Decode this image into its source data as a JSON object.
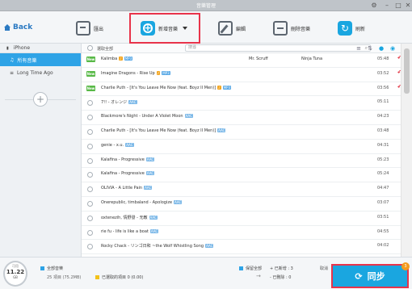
{
  "window": {
    "title": "音樂管理",
    "settings_icon": "gear-icon"
  },
  "toolbar": {
    "back_label": "Back",
    "export_label": "匯出",
    "add_label": "新增音樂",
    "edit_label": "編輯",
    "delete_label": "刪除音樂",
    "refresh_label": "刷新"
  },
  "sidebar": {
    "device": "iPhone",
    "items": [
      {
        "label": "所有音樂",
        "active": true
      },
      {
        "label": "Long Time Ago",
        "active": false
      }
    ]
  },
  "list": {
    "select_all_label": "選取全部",
    "search_placeholder": "搜尋",
    "rows": [
      {
        "new": true,
        "name": "Kalimba",
        "badges": [
          "flag",
          "mp3"
        ],
        "artist": "Mr. Scruff",
        "album": "Ninja Tuna",
        "duration": "05:48",
        "undo": true
      },
      {
        "new": true,
        "name": "Imagine Dragons - Rise Up",
        "badges": [
          "flag",
          "mp3"
        ],
        "artist": "",
        "album": "",
        "duration": "03:52",
        "undo": true
      },
      {
        "new": true,
        "name": "Charlie Puth - [It's You Leave Me Now (feat. Boyz II Men)]",
        "badges": [
          "flag",
          "mp3"
        ],
        "artist": "",
        "album": "",
        "duration": "03:56",
        "undo": true
      },
      {
        "new": false,
        "name": "7!! - オレンジ",
        "badges": [
          "aac"
        ],
        "artist": "",
        "album": "",
        "duration": "05:11",
        "undo": false
      },
      {
        "new": false,
        "name": "Blackmore's Night - Under A Violet Moon",
        "badges": [
          "aac"
        ],
        "artist": "",
        "album": "",
        "duration": "04:23",
        "undo": false
      },
      {
        "new": false,
        "name": "Charlie Puth - [It's You Leave Me Now (feat. Boyz II Men)]",
        "badges": [
          "aac"
        ],
        "artist": "",
        "album": "",
        "duration": "03:48",
        "undo": false
      },
      {
        "new": false,
        "name": "genie - x.u.",
        "badges": [
          "aac"
        ],
        "artist": "",
        "album": "",
        "duration": "04:31",
        "undo": false
      },
      {
        "new": false,
        "name": "Kalafina - Progressive",
        "badges": [
          "aac"
        ],
        "artist": "",
        "album": "",
        "duration": "05:23",
        "undo": false
      },
      {
        "new": false,
        "name": "Kalafina - Progressive",
        "badges": [
          "aac"
        ],
        "artist": "",
        "album": "",
        "duration": "05:24",
        "undo": false
      },
      {
        "new": false,
        "name": "OLIVIA - A Little Pain",
        "badges": [
          "aac"
        ],
        "artist": "",
        "album": "",
        "duration": "04:47",
        "undo": false
      },
      {
        "new": false,
        "name": "Onerepublic, timbaland - Apologize",
        "badges": [
          "aac"
        ],
        "artist": "",
        "album": "",
        "duration": "03:07",
        "undo": false
      },
      {
        "new": false,
        "name": "oxtenezih, 情野發 - 无敵",
        "badges": [
          "aac"
        ],
        "artist": "",
        "album": "",
        "duration": "03:51",
        "undo": false
      },
      {
        "new": false,
        "name": "rie fu - life is like a boat",
        "badges": [
          "aac"
        ],
        "artist": "",
        "album": "",
        "duration": "04:55",
        "undo": false
      },
      {
        "new": false,
        "name": "Rocky Chack - リンゴ日和 ~the Wolf Whistling Song",
        "badges": [
          "aac"
        ],
        "artist": "",
        "album": "",
        "duration": "04:02",
        "undo": false
      }
    ]
  },
  "footer": {
    "storage_label": "可用",
    "storage_value": "11.22",
    "storage_unit": "GB",
    "all_music_label": "全部音樂",
    "all_music_detail": "25 項目 (75.2MB)",
    "selected_label": "已選取的項目 0 (0.00)",
    "keep_all_label": "保留全部",
    "added_label": "+ 已新增 : 3",
    "deleted_label": "- 已刪除 : 0",
    "cancel_label": "取消",
    "sync_label": "同步",
    "sync_badge": "3"
  },
  "colors": {
    "accent": "#1aa6e0",
    "highlight": "#e8334a",
    "new_tag": "#58b947",
    "undo": "#e02b3a"
  }
}
